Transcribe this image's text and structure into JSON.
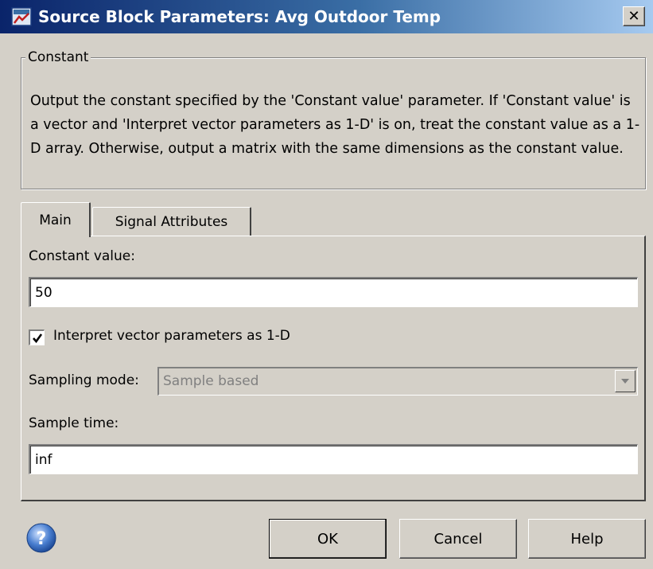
{
  "window": {
    "title": "Source Block Parameters: Avg Outdoor Temp",
    "close_label": "✕"
  },
  "group": {
    "legend": "Constant",
    "description": "Output the constant specified by the 'Constant value' parameter. If 'Constant value' is a vector and 'Interpret vector parameters as 1-D' is on, treat the constant value as a 1-D array. Otherwise, output a matrix with the same dimensions as the constant value."
  },
  "tabs": [
    {
      "label": "Main",
      "active": true
    },
    {
      "label": "Signal Attributes",
      "active": false
    }
  ],
  "main": {
    "constant_value_label": "Constant value:",
    "constant_value": "50",
    "interpret_checkbox_label": "Interpret vector parameters as 1-D",
    "interpret_checked": true,
    "sampling_mode_label": "Sampling mode:",
    "sampling_mode_value": "Sample based",
    "sampling_mode_enabled": false,
    "sample_time_label": "Sample time:",
    "sample_time_value": "inf"
  },
  "buttons": {
    "ok": "OK",
    "cancel": "Cancel",
    "help": "Help"
  },
  "icons": {
    "app": "simulink-block-icon",
    "help": "question-mark-icon",
    "close": "close-icon"
  },
  "colors": {
    "titlebar_start": "#0a246a",
    "titlebar_end": "#a6caf0",
    "dialog_bg": "#d4d0c8"
  }
}
